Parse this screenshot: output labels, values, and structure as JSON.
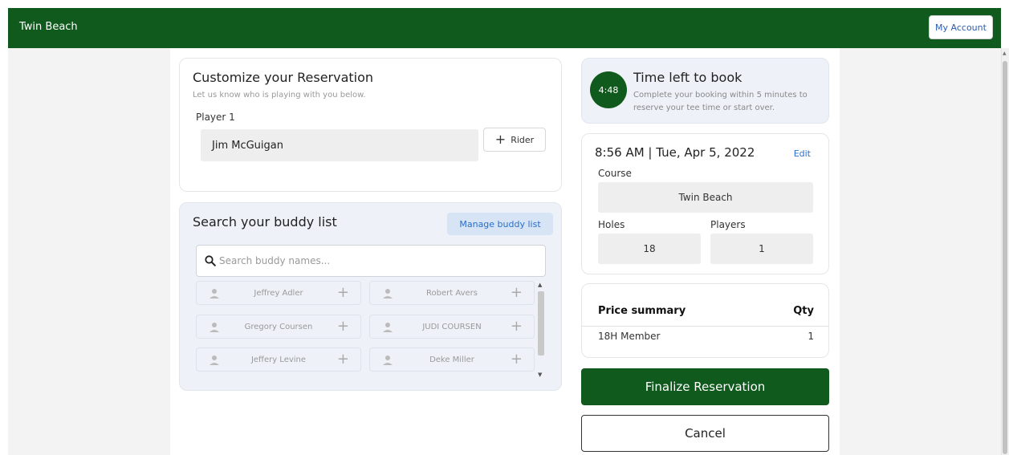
{
  "header": {
    "brand": "Twin Beach",
    "account_label": "My Account"
  },
  "customize": {
    "title": "Customize your Reservation",
    "subtitle": "Let us know who is playing with you below.",
    "player_label": "Player 1",
    "player_name": "Jim McGuigan",
    "rider_label": "Rider",
    "rider_icon": "plus-icon"
  },
  "buddy": {
    "title": "Search your buddy list",
    "manage_label": "Manage buddy list",
    "search_placeholder": "Search buddy names...",
    "items": [
      {
        "name": "Jeffrey Adler"
      },
      {
        "name": "Robert Avers"
      },
      {
        "name": "Gregory Coursen"
      },
      {
        "name": "JUDI COURSEN"
      },
      {
        "name": "Jeffery Levine"
      },
      {
        "name": "Deke Miller"
      }
    ]
  },
  "timer": {
    "time_left": "4:48",
    "title": "Time left to book",
    "description": "Complete your booking within 5 minutes to reserve your tee time or start over."
  },
  "booking": {
    "datetime": "8:56 AM | Tue, Apr 5, 2022",
    "edit_label": "Edit",
    "course_label": "Course",
    "course_value": "Twin Beach",
    "holes_label": "Holes",
    "holes_value": "18",
    "players_label": "Players",
    "players_value": "1"
  },
  "price": {
    "summary_label": "Price summary",
    "qty_label": "Qty",
    "item_name": "18H Member",
    "item_qty": "1"
  },
  "actions": {
    "finalize_label": "Finalize Reservation",
    "cancel_label": "Cancel"
  },
  "colors": {
    "brand_green": "#0f5a1c",
    "link_blue": "#2a6fc9",
    "panel_blue": "#eef2f8"
  }
}
